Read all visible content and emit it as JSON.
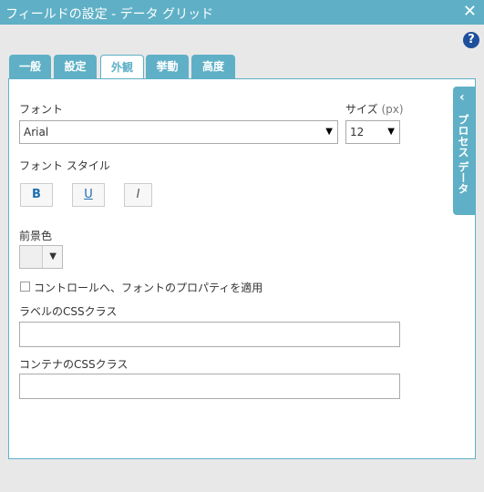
{
  "window": {
    "title": "フィールドの設定 - データ グリッド",
    "close_symbol": "✕",
    "help_symbol": "?"
  },
  "tabs": [
    {
      "label": "一般"
    },
    {
      "label": "設定"
    },
    {
      "label": "外観",
      "active": true
    },
    {
      "label": "挙動"
    },
    {
      "label": "高度"
    }
  ],
  "font": {
    "label": "フォント",
    "value": "Arial"
  },
  "size": {
    "label": "サイズ",
    "unit": "(px)",
    "value": "12"
  },
  "font_style": {
    "label": "フォント スタイル",
    "bold": "B",
    "underline": "U",
    "italic": "I"
  },
  "foreground": {
    "label": "前景色"
  },
  "apply_font": {
    "label": "コントロールへ、フォントのプロパティを適用",
    "checked": false
  },
  "label_css": {
    "label": "ラベルのCSSクラス",
    "value": ""
  },
  "container_css": {
    "label": "コンテナのCSSクラス",
    "value": ""
  },
  "side_panel": {
    "label": "プロセス データ",
    "chevron": "‹"
  },
  "dropdown_symbol": "▼",
  "colors": {
    "accent": "#5fb0c6",
    "help": "#1e4f9c",
    "button_text": "#1f6fb0"
  }
}
